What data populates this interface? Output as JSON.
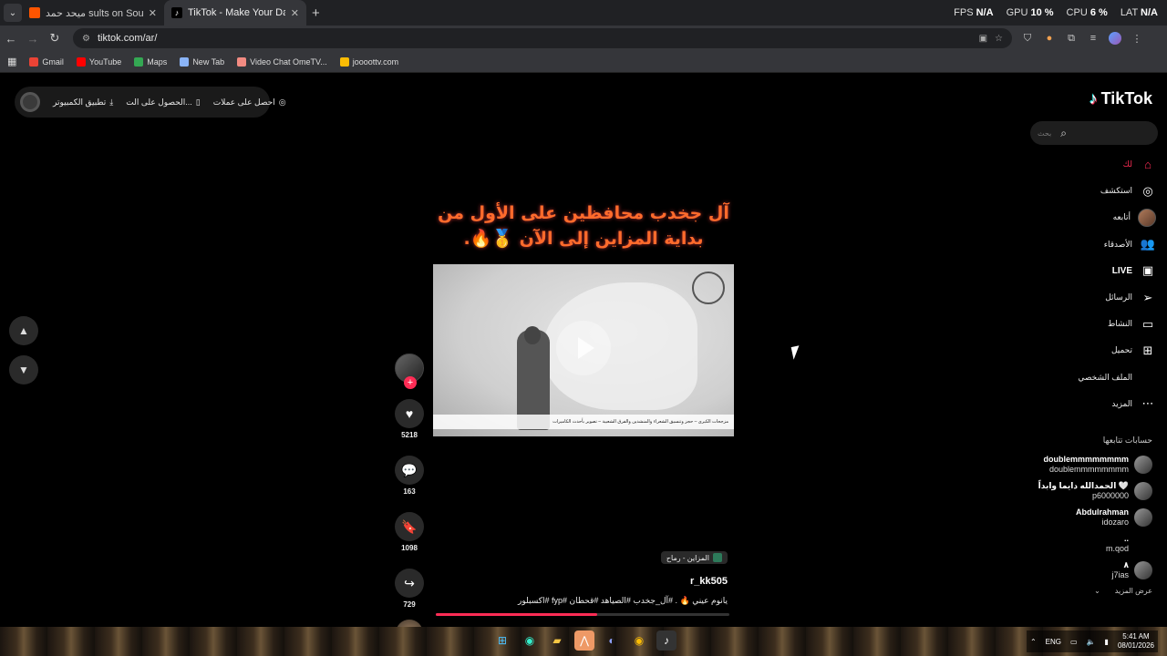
{
  "browser": {
    "tabs": [
      {
        "label": "ميحد حمد sults on SoundCloud",
        "favicon_color": "#ff5500",
        "active": false
      },
      {
        "label": "TikTok - Make Your Day",
        "favicon_color": "#000000",
        "active": true
      }
    ],
    "perf": {
      "fps_label": "FPS",
      "fps": "N/A",
      "gpu_label": "GPU",
      "gpu": "10 %",
      "cpu_label": "CPU",
      "cpu": "6 %",
      "lat_label": "LAT",
      "lat": "N/A"
    },
    "url": "tiktok.com/ar/",
    "bookmarks": [
      {
        "label": "Gmail",
        "color": "#ea4335"
      },
      {
        "label": "YouTube",
        "color": "#ff0000"
      },
      {
        "label": "Maps",
        "color": "#34a853"
      },
      {
        "label": "New Tab",
        "color": "#8ab4f8"
      },
      {
        "label": "Video Chat OmeTV...",
        "color": "#f28b82"
      },
      {
        "label": "joooottv.com",
        "color": "#fbbc04"
      }
    ]
  },
  "promo": {
    "coins": "احصل على عملات",
    "app": "الحصول على الت...",
    "desktop": "تطبيق الكمبيوتر"
  },
  "video": {
    "caption_line1": "آل جخدب محافظين على الأول من",
    "caption_line2": "بداية المزاين إلى الآن 🥇🔥.",
    "ticker": "مزجحات الكبرى – حجز وتنسيق الشعراء والمنشدين والفرق الشعبية – تصوير بأحدث الكاميرات",
    "sound": "المزاين - رماح",
    "username": "r_kk505",
    "description": "يانوم عيني 🔥 . #آل_جخدب #الصياهد #قحطان #fyp #اكسبلور",
    "progress_fraction": 0.55
  },
  "actions": {
    "likes": "5218",
    "comments": "163",
    "saves": "1098",
    "shares": "729"
  },
  "sidebar": {
    "brand": "TikTok",
    "search_placeholder": "بحث",
    "nav": {
      "for_you": "لك",
      "explore": "استكشف",
      "following": "أتابعه",
      "friends": "الأصدقاء",
      "live": "LIVE",
      "messages": "الرسائل",
      "activity": "النشاط",
      "upload": "تحميل",
      "profile": "الملف الشخصي",
      "more": "المزيد"
    },
    "following_heading": "حسابات تتابعها",
    "accounts": [
      {
        "name": "doublemmmmmmmm",
        "handle": "doublemmmmmmmm"
      },
      {
        "name": "الحمدالله دايما وابداً 🤍",
        "handle": "p6000000"
      },
      {
        "name": "Abdulrahman",
        "handle": "idozaro"
      },
      {
        "name": "..",
        "handle": "m.qod"
      },
      {
        "name": "٨",
        "handle": "j7ias"
      }
    ],
    "see_more": "عرض المزيد"
  },
  "taskbar": {
    "lang": "ENG",
    "time": "5:41 AM",
    "date": "08/01/2026"
  }
}
